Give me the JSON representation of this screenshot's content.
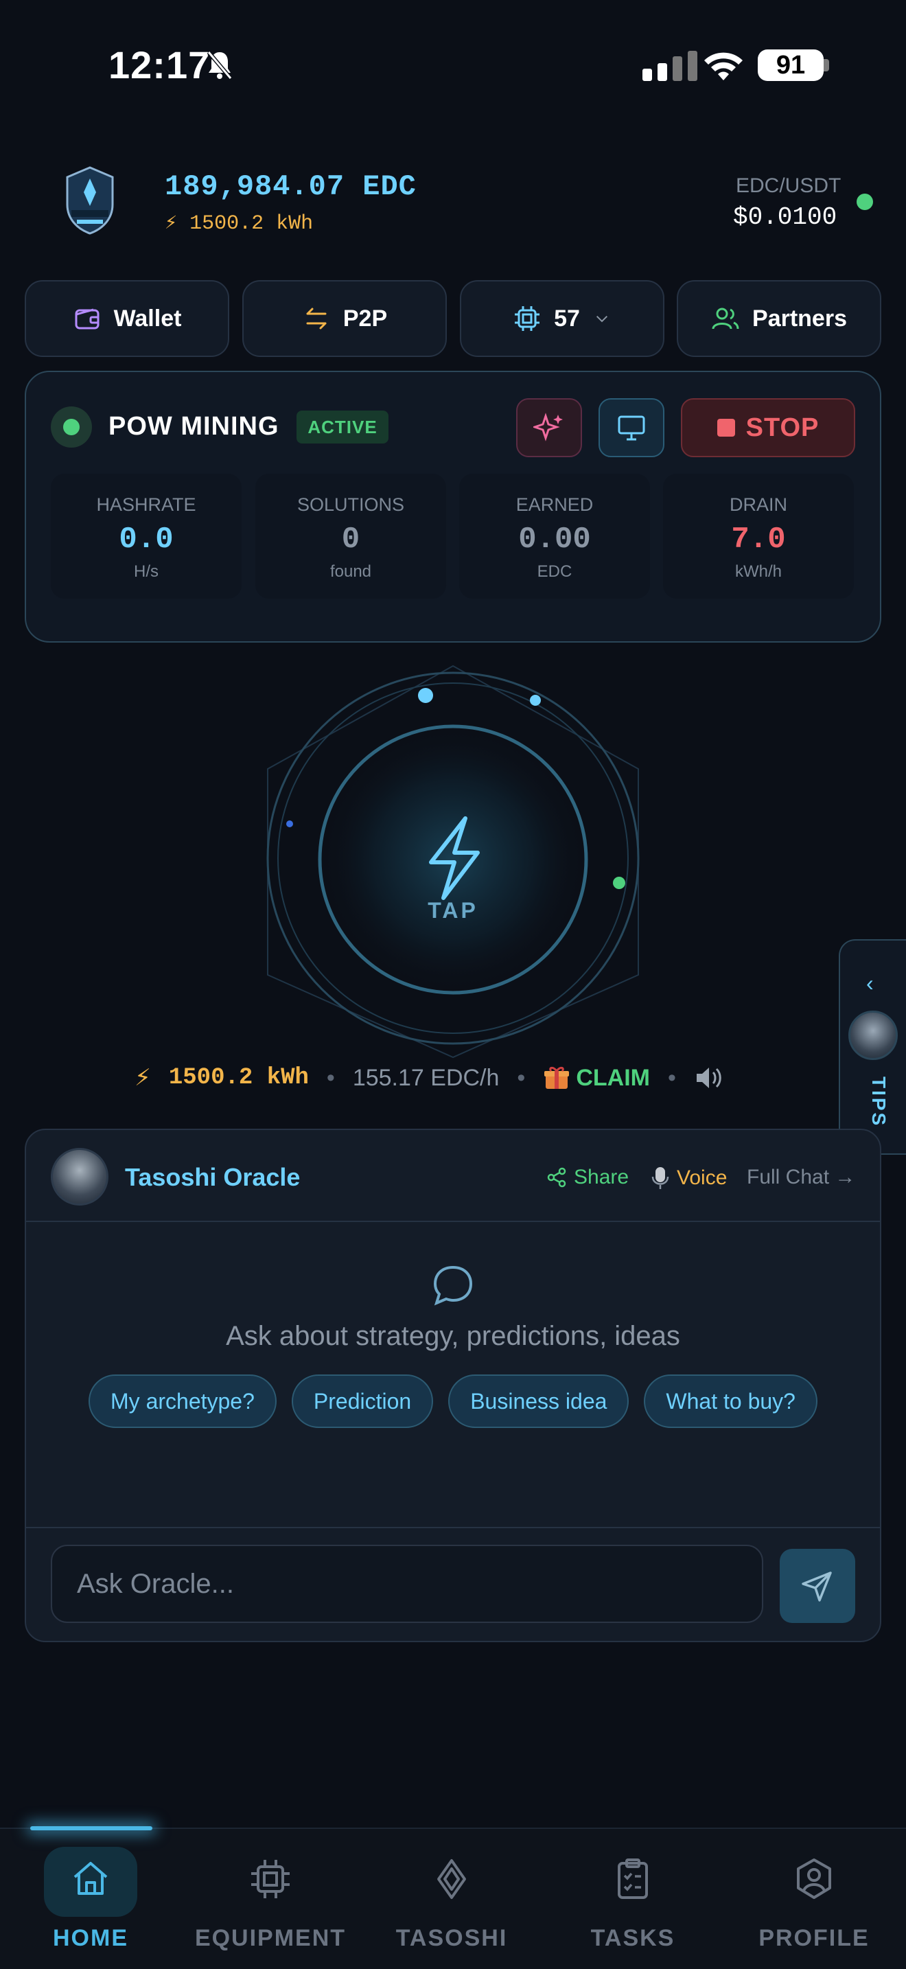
{
  "status_bar": {
    "time": "12:17",
    "battery": "91"
  },
  "header": {
    "balance": "189,984.07 EDC",
    "energy": "⚡ 1500.2 kWh",
    "pair_label": "EDC/USDT",
    "pair_price": "$0.0100"
  },
  "nav_buttons": {
    "wallet": "Wallet",
    "p2p": "P2P",
    "chip_count": "57",
    "partners": "Partners"
  },
  "mining": {
    "title": "POW MINING",
    "badge": "ACTIVE",
    "stop_label": "STOP",
    "stats": [
      {
        "label": "HASHRATE",
        "value": "0.0",
        "unit": "H/s",
        "color": "#6fd1ff"
      },
      {
        "label": "SOLUTIONS",
        "value": "0",
        "unit": "found",
        "color": "#8b96a4"
      },
      {
        "label": "EARNED",
        "value": "0.00",
        "unit": "EDC",
        "color": "#8b96a4"
      },
      {
        "label": "DRAIN",
        "value": "7.0",
        "unit": "kWh/h",
        "color": "#f0646c"
      }
    ]
  },
  "tap": {
    "label": "TAP"
  },
  "tips": {
    "label": "TIPS"
  },
  "energy_stats": {
    "kwh": "1500.2 kWh",
    "rate": "155.17 EDC/h",
    "claim": "CLAIM"
  },
  "oracle": {
    "name": "Tasoshi Oracle",
    "share": "Share",
    "voice": "Voice",
    "full_chat": "Full Chat →",
    "prompt": "Ask about strategy, predictions, ideas",
    "chips": [
      "My archetype?",
      "Prediction",
      "Business idea",
      "What to buy?"
    ],
    "input_placeholder": "Ask Oracle..."
  },
  "bottom_nav": {
    "home": "HOME",
    "equipment": "EQUIPMENT",
    "tasoshi": "TASOSHI",
    "tasks": "TASKS",
    "profile": "PROFILE"
  },
  "colors": {
    "accent": "#6fd1ff",
    "energy": "#f3b54a",
    "success": "#4fd17e",
    "danger": "#f0646c",
    "background": "#0b0f17"
  }
}
